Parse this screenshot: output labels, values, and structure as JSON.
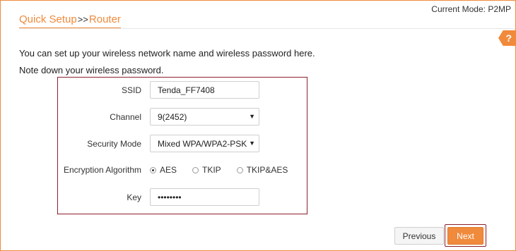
{
  "header": {
    "current_mode_label": "Current Mode: P2MP",
    "crumb_parent": "Quick Setup",
    "crumb_separator": ">>",
    "crumb_current": "Router",
    "help_symbol": "?"
  },
  "intro": {
    "line1": "You can set up your wireless network name and wireless password here.",
    "line2": "Note down your wireless password."
  },
  "form": {
    "ssid_label": "SSID",
    "ssid_value": "Tenda_FF7408",
    "channel_label": "Channel",
    "channel_value": "9(2452)",
    "security_label": "Security Mode",
    "security_value": "Mixed WPA/WPA2-PSK",
    "encryption_label": "Encryption Algorithm",
    "encryption_options": [
      "AES",
      "TKIP",
      "TKIP&AES"
    ],
    "encryption_selected": "AES",
    "key_label": "Key",
    "key_value": "••••••••"
  },
  "buttons": {
    "previous": "Previous",
    "next": "Next"
  },
  "colors": {
    "accent": "#f08a3c",
    "highlight_border": "#8b1f2c"
  }
}
